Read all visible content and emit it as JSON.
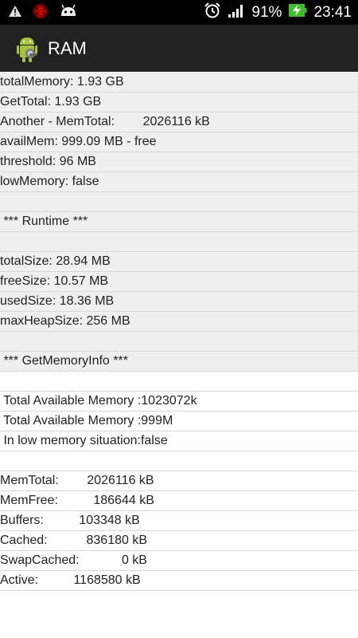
{
  "status_bar": {
    "battery_percent": "91%",
    "time": "23:41",
    "icons": [
      "warning-icon",
      "spider-icon",
      "android-notification-icon",
      "alarm-icon",
      "signal-icon",
      "battery-charging-icon"
    ]
  },
  "action_bar": {
    "title": "RAM",
    "icon": "android-robot-icon"
  },
  "rows": [
    "totalMemory: 1.93 GB",
    "GetTotal: 1.93 GB",
    "Another - MemTotal:        2026116 kB",
    "availMem: 999.09 MB - free",
    "threshold: 96 MB",
    "lowMemory: false",
    "",
    " *** Runtime ***",
    "",
    "totalSize: 28.94 MB",
    "freeSize: 10.57 MB",
    "usedSize: 18.36 MB",
    "maxHeapSize: 256 MB",
    "",
    " *** GetMemoryInfo ***",
    "",
    " Total Available Memory :1023072k",
    " Total Available Memory :999M",
    " In low memory situation:false",
    "",
    "MemTotal:        2026116 kB",
    "MemFree:          186644 kB",
    "Buffers:          103348 kB",
    "Cached:           836180 kB",
    "SwapCached:            0 kB",
    "Active:          1168580 kB"
  ]
}
